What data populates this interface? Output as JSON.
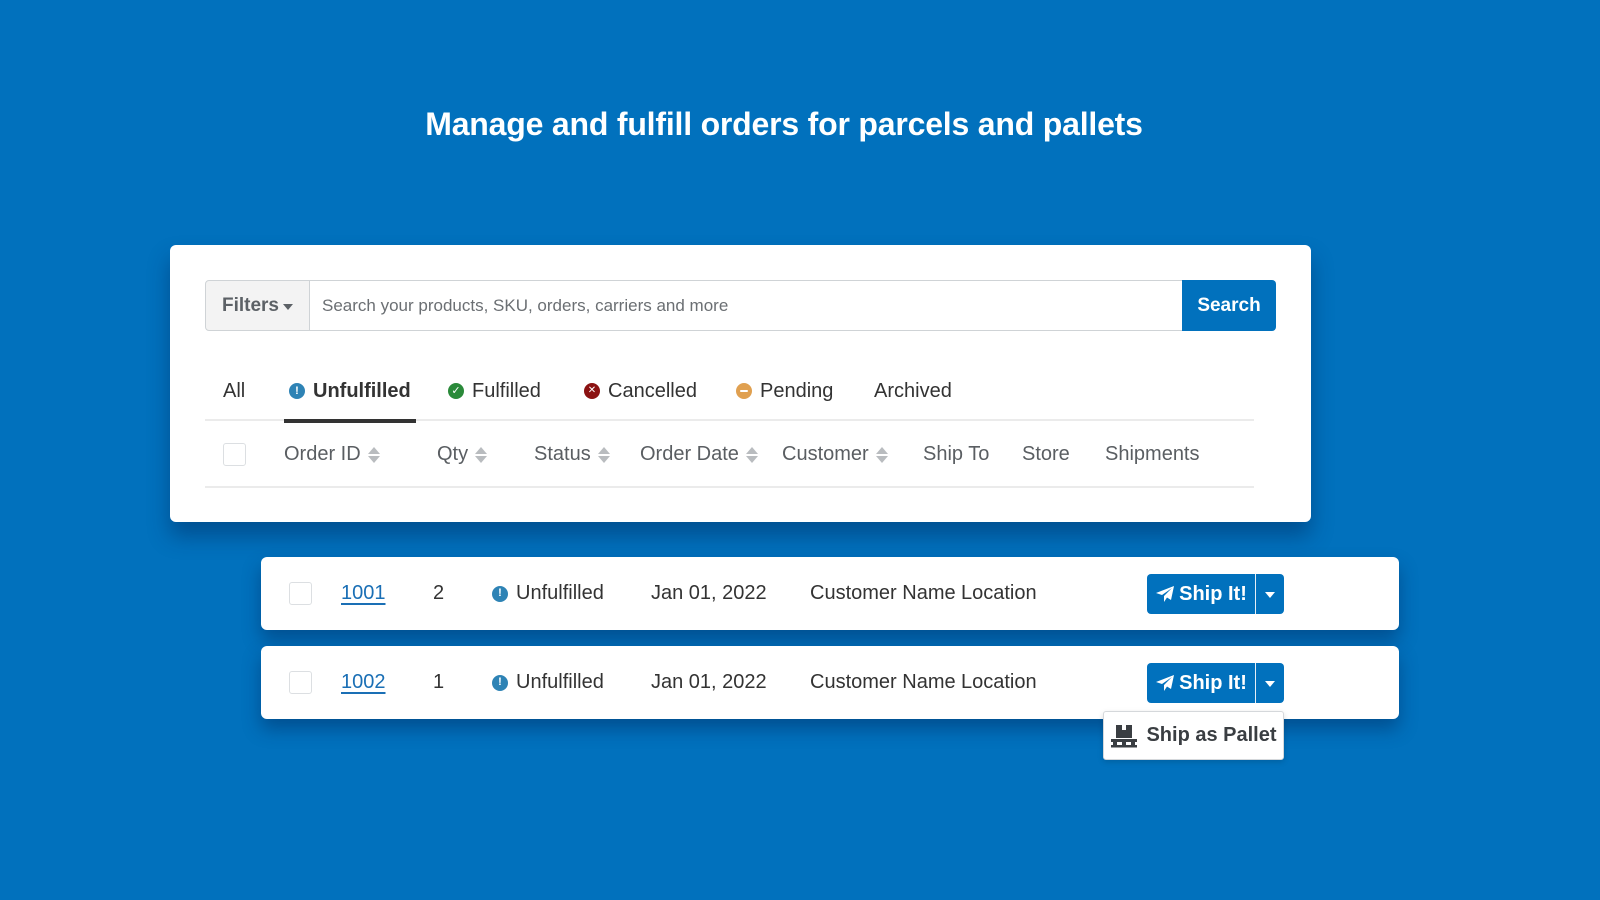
{
  "headline": "Manage and fulfill orders for parcels and pallets",
  "colors": {
    "background": "#0171bd",
    "primary": "#0171bd",
    "unfulfilled": "#2e83b5",
    "fulfilled": "#2a8a3a",
    "cancelled": "#8b1212",
    "pending": "#e0a050",
    "link": "#1a6fb5"
  },
  "search": {
    "filters_label": "Filters",
    "placeholder": "Search your products, SKU, orders, carriers and more",
    "value": "",
    "button_label": "Search"
  },
  "tabs": [
    {
      "label": "All",
      "icon": null,
      "active": false
    },
    {
      "label": "Unfulfilled",
      "icon": "exclamation-circle-icon",
      "active": true
    },
    {
      "label": "Fulfilled",
      "icon": "check-circle-icon",
      "active": false
    },
    {
      "label": "Cancelled",
      "icon": "x-circle-icon",
      "active": false
    },
    {
      "label": "Pending",
      "icon": "minus-circle-icon",
      "active": false
    },
    {
      "label": "Archived",
      "icon": null,
      "active": false
    }
  ],
  "columns": [
    {
      "label": "Order ID",
      "sortable": true
    },
    {
      "label": "Qty",
      "sortable": true
    },
    {
      "label": "Status",
      "sortable": true
    },
    {
      "label": "Order Date",
      "sortable": true
    },
    {
      "label": "Customer",
      "sortable": true
    },
    {
      "label": "Ship To",
      "sortable": false
    },
    {
      "label": "Store",
      "sortable": false
    },
    {
      "label": "Shipments",
      "sortable": false
    }
  ],
  "orders": [
    {
      "id": "1001",
      "qty": "2",
      "status": "Unfulfilled",
      "date": "Jan 01, 2022",
      "customer": "Customer Name",
      "ship_to": "Location",
      "action": "Ship It!"
    },
    {
      "id": "1002",
      "qty": "1",
      "status": "Unfulfilled",
      "date": "Jan 01, 2022",
      "customer": "Customer Name",
      "ship_to": "Location",
      "action": "Ship It!"
    }
  ],
  "dropdown": {
    "items": [
      {
        "label": "Ship as Pallet",
        "icon": "pallet-icon"
      }
    ]
  }
}
